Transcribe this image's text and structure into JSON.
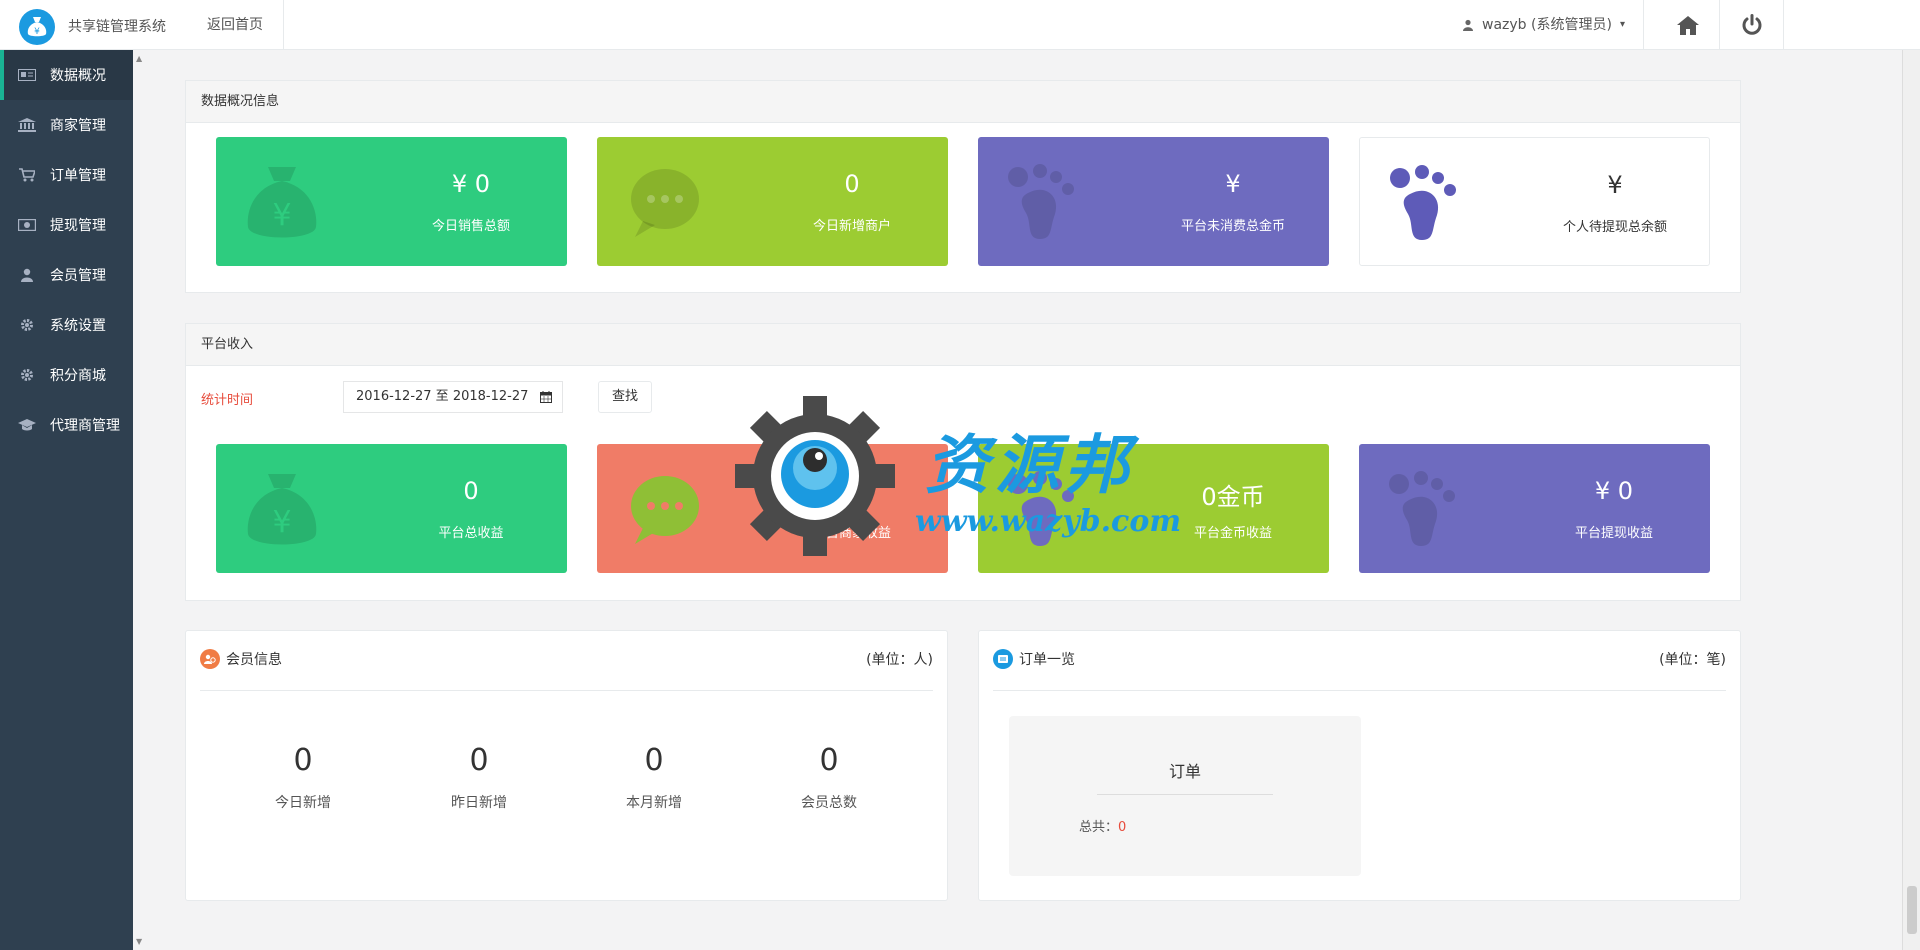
{
  "app": {
    "brand": "共享链管理系统",
    "back_home": "返回首页"
  },
  "user": {
    "name": "wazyb (系统管理员)"
  },
  "sidebar": {
    "items": [
      {
        "label": "数据概况",
        "icon": "newspaper-icon"
      },
      {
        "label": "商家管理",
        "icon": "bank-icon"
      },
      {
        "label": "订单管理",
        "icon": "cart-icon"
      },
      {
        "label": "提现管理",
        "icon": "money-icon"
      },
      {
        "label": "会员管理",
        "icon": "user-icon"
      },
      {
        "label": "系统设置",
        "icon": "gear-icon"
      },
      {
        "label": "积分商城",
        "icon": "gear-icon"
      },
      {
        "label": "代理商管理",
        "icon": "graduation-cap-icon"
      }
    ]
  },
  "overview": {
    "title": "数据概况信息",
    "cards": [
      {
        "value": "¥ 0",
        "caption": "今日销售总额",
        "color": "#2ecc7f",
        "icon": "money-bag-icon"
      },
      {
        "value": "0",
        "caption": "今日新增商户",
        "color": "#9ccc32",
        "icon": "chat-bubble-icon"
      },
      {
        "value": "¥",
        "caption": "平台未消费总金币",
        "color": "#6e6bbf",
        "icon": "paw-icon"
      },
      {
        "value": "¥",
        "caption": "个人待提现总余额",
        "color": "#ffffff",
        "icon": "paw-icon"
      }
    ]
  },
  "income": {
    "title": "平台收入",
    "time_label": "统计时间",
    "date_range": "2016-12-27 至 2018-12-27",
    "find_label": "查找",
    "cards": [
      {
        "value": "0",
        "caption": "平台总收益",
        "color": "#2ecc7f",
        "icon": "money-bag-icon"
      },
      {
        "value": "0",
        "caption": "平台商家收益",
        "color": "#f07c67",
        "icon": "chat-bubble-icon"
      },
      {
        "value": "0金币",
        "caption": "平台金币收益",
        "color": "#9ccc32",
        "icon": "paw-icon"
      },
      {
        "value": "¥ 0",
        "caption": "平台提现收益",
        "color": "#6e6bbf",
        "icon": "paw-icon"
      }
    ]
  },
  "members": {
    "title": "会员信息",
    "unit": "(单位：人)",
    "stats": [
      {
        "num": "0",
        "label": "今日新增"
      },
      {
        "num": "0",
        "label": "昨日新增"
      },
      {
        "num": "0",
        "label": "本月新增"
      },
      {
        "num": "0",
        "label": "会员总数"
      }
    ]
  },
  "orders": {
    "title": "订单一览",
    "unit": "(单位：笔)",
    "box_title": "订单",
    "total_label": "总共：",
    "total_value": "0"
  },
  "watermark": {
    "name": "资源邦",
    "url": "www.wazyb.com"
  }
}
